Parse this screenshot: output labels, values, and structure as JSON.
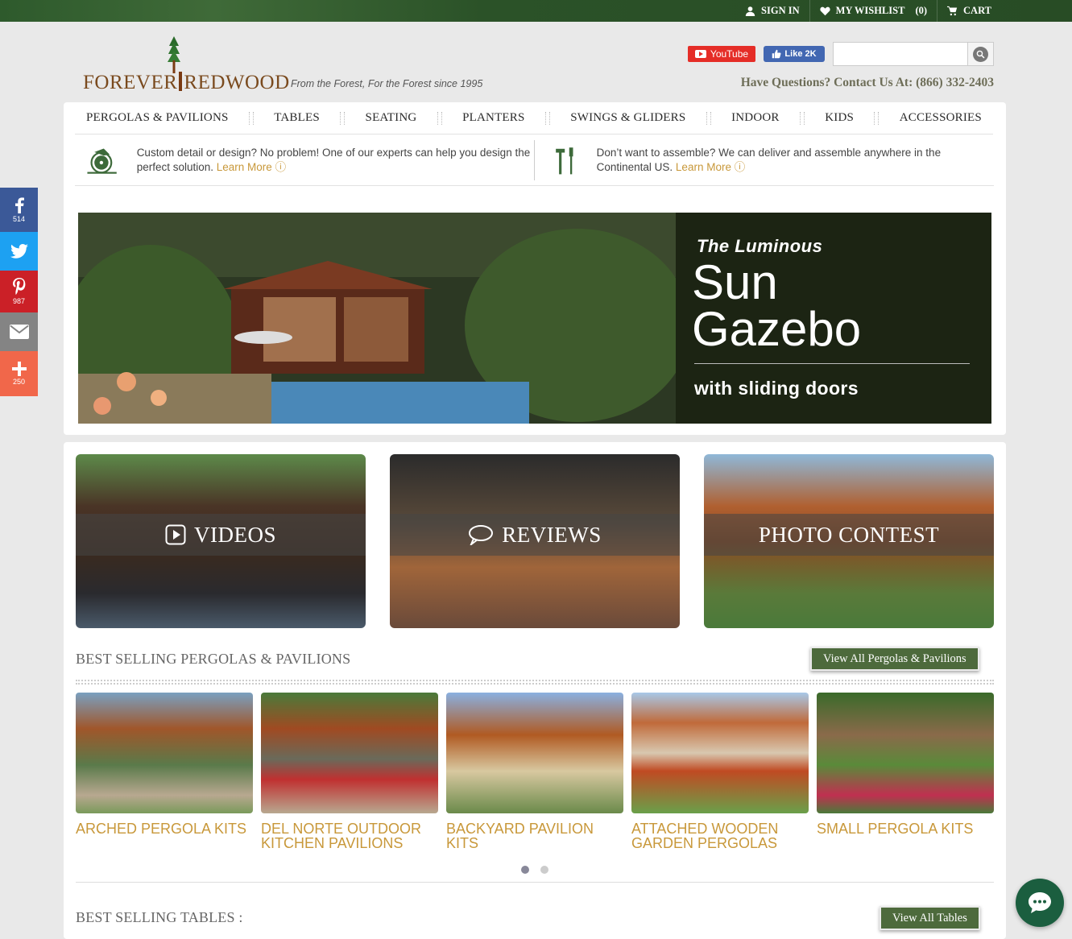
{
  "topbar": {
    "sign_in": "SIGN IN",
    "wishlist": "MY WISHLIST",
    "wishlist_count": "(0)",
    "cart": "CART"
  },
  "header": {
    "logo_left": "FOREVER",
    "logo_right": "REDWOOD",
    "tagline": "From the Forest, For the Forest since 1995",
    "youtube": "YouTube",
    "fb_like": "Like 2K",
    "search_placeholder": "",
    "contact": "Have Questions? Contact Us At: (866) 332-2403"
  },
  "nav": {
    "items": [
      "PERGOLAS & PAVILIONS",
      "TABLES",
      "SEATING",
      "PLANTERS",
      "SWINGS & GLIDERS",
      "INDOOR",
      "KIDS",
      "ACCESSORIES"
    ]
  },
  "promo": {
    "left_text": "Custom detail or design? No problem! One of our experts can help you design the perfect solution.",
    "right_text": "Don’t want to assemble? We can deliver and assemble anywhere in the Continental US.",
    "learn_more": "Learn More"
  },
  "hero": {
    "kicker": "The Luminous",
    "title_line1": "Sun",
    "title_line2": "Gazebo",
    "subtitle": "with sliding doors"
  },
  "tiles": {
    "videos": "VIDEOS",
    "reviews": "REVIEWS",
    "photo_contest": "PHOTO CONTEST"
  },
  "pergolas": {
    "title": "BEST SELLING PERGOLAS & PAVILIONS",
    "view_all": "View All Pergolas & Pavilions",
    "products": [
      "ARCHED PERGOLA KITS",
      "DEL NORTE OUTDOOR KITCHEN PAVILIONS",
      "BACKYARD PAVILION KITS",
      "ATTACHED WOODEN GARDEN PERGOLAS",
      "SMALL PERGOLA KITS"
    ]
  },
  "tables": {
    "title": "BEST SELLING TABLES :",
    "view_all": "View All Tables"
  },
  "share": {
    "facebook_count": "514",
    "pinterest_count": "987",
    "more_count": "250"
  },
  "colors": {
    "brand_green": "#2b5228",
    "accent_gold": "#c8983a",
    "button_green": "#4d6a3c"
  }
}
